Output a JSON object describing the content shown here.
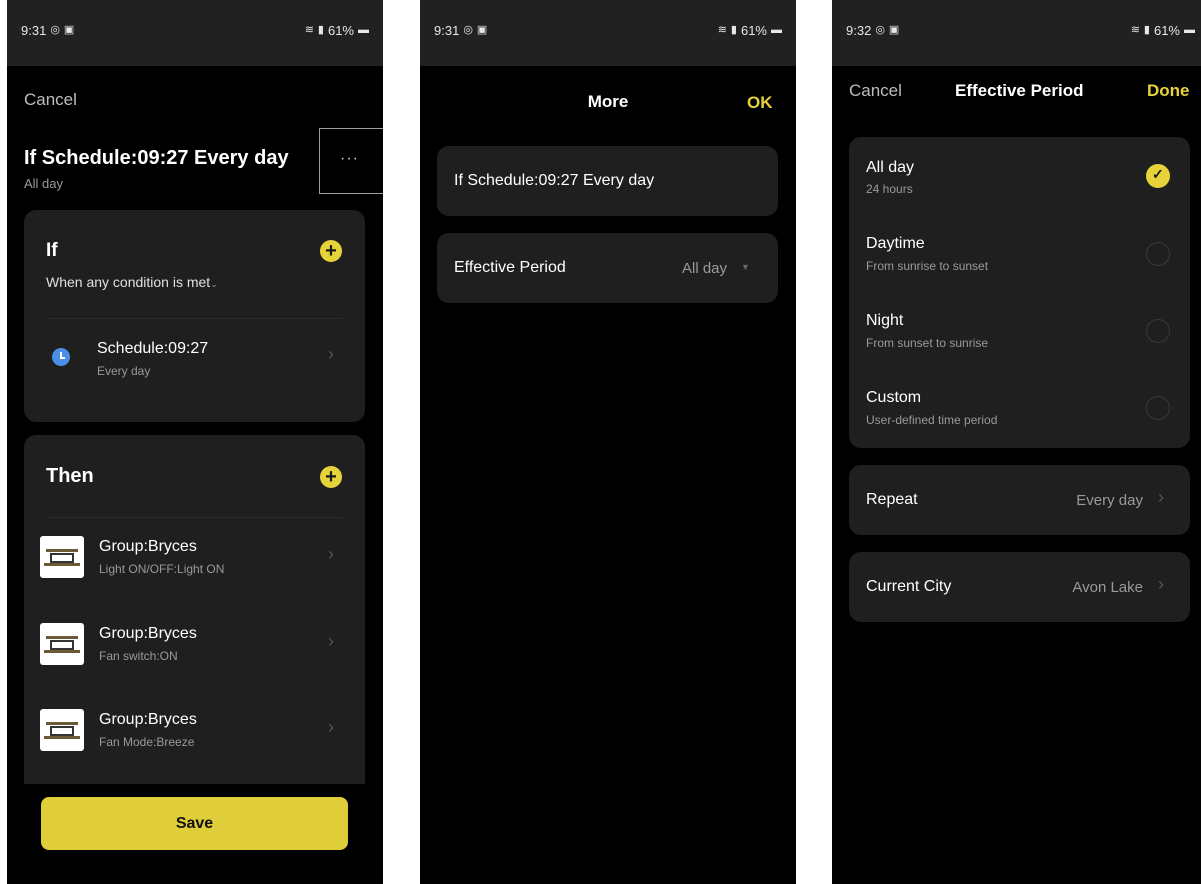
{
  "screens": [
    {
      "status": {
        "time": "9:31",
        "battery": "61%"
      },
      "header": {
        "cancel": "Cancel",
        "title": "If Schedule:09:27 Every day",
        "subtitle": "All day",
        "more_label": "···"
      },
      "if_card": {
        "title": "If",
        "condition_mode": "When any condition is met",
        "conditions": [
          {
            "title": "Schedule:09:27",
            "subtitle": "Every day"
          }
        ]
      },
      "then_card": {
        "title": "Then",
        "actions": [
          {
            "title": "Group:Bryces",
            "subtitle": "Light ON/OFF:Light ON"
          },
          {
            "title": "Group:Bryces",
            "subtitle": "Fan switch:ON"
          },
          {
            "title": "Group:Bryces",
            "subtitle": "Fan Mode:Breeze"
          }
        ]
      },
      "save_label": "Save"
    },
    {
      "status": {
        "time": "9:31",
        "battery": "61%"
      },
      "header": {
        "title": "More",
        "ok": "OK"
      },
      "name_value": "If Schedule:09:27 Every day",
      "effective_period": {
        "label": "Effective Period",
        "value": "All day"
      }
    },
    {
      "status": {
        "time": "9:32",
        "battery": "61%"
      },
      "header": {
        "cancel": "Cancel",
        "title": "Effective Period",
        "done": "Done"
      },
      "options": [
        {
          "title": "All day",
          "subtitle": "24 hours",
          "selected": true
        },
        {
          "title": "Daytime",
          "subtitle": "From sunrise to sunset",
          "selected": false
        },
        {
          "title": "Night",
          "subtitle": "From sunset to sunrise",
          "selected": false
        },
        {
          "title": "Custom",
          "subtitle": "User-defined time period",
          "selected": false
        }
      ],
      "repeat": {
        "label": "Repeat",
        "value": "Every day"
      },
      "city": {
        "label": "Current City",
        "value": "Avon Lake"
      }
    }
  ],
  "colors": {
    "accent": "#e6d33a",
    "background": "#000000",
    "card": "#1f1f1f",
    "statusbar": "#212121",
    "clock_icon": "#4a8ee8"
  },
  "icons": [
    "instagram-icon",
    "gallery-icon",
    "wifi-icon",
    "signal-icon",
    "battery-icon",
    "clock-icon",
    "plus-icon",
    "chevron-right-icon",
    "chevron-down-icon",
    "check-icon",
    "device-thumbnail"
  ]
}
